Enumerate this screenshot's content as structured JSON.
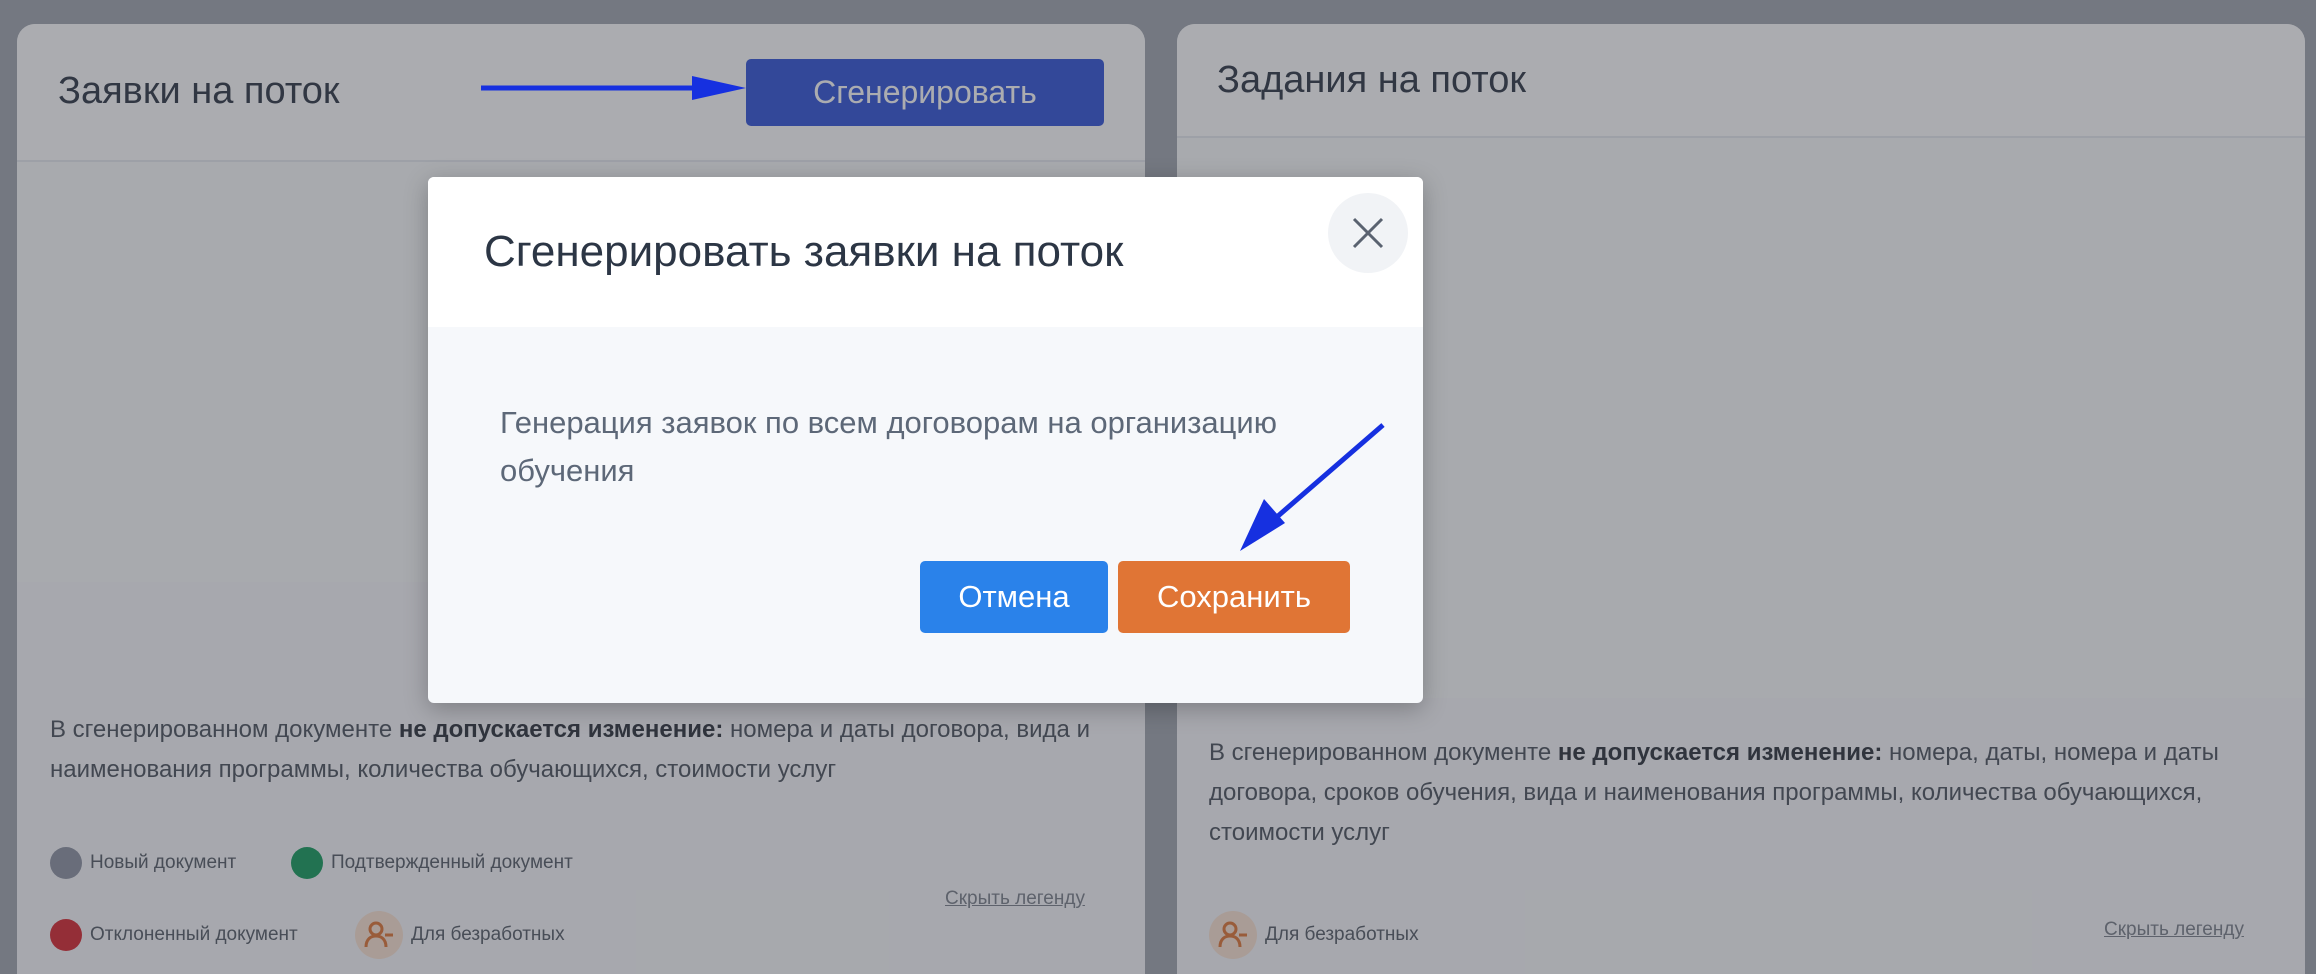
{
  "left_panel": {
    "title": "Заявки на поток",
    "generate_button": "Сгенерировать",
    "note_prefix": "В сгенерированном документе ",
    "note_bold": "не допускается изменение:",
    "note_rest": " номера и даты договора, вида и наименования программы, количества обучающихся, стоимости услуг",
    "legend": [
      {
        "label": "Новый документ",
        "color": "#8e93a3"
      },
      {
        "label": "Подтвержденный документ",
        "color": "#139b5c"
      },
      {
        "label": "Отклоненный документ",
        "color": "#d8262f"
      },
      {
        "label": "Для безработных",
        "icon": "unemployed-person-icon"
      }
    ],
    "hide_legend": "Скрыть легенду"
  },
  "right_panel": {
    "title": "Задания на поток",
    "note_prefix": "В сгенерированном документе ",
    "note_bold": "не допускается изменение:",
    "note_rest": " номера, даты, номера и даты договора, сроков обучения, вида и наименования программы, количества обучающихся, стоимости услуг",
    "legend": [
      {
        "label": "Для безработных",
        "icon": "unemployed-person-icon"
      }
    ],
    "hide_legend": "Скрыть легенду"
  },
  "modal": {
    "title": "Сгенерировать заявки на поток",
    "body": "Генерация заявок по всем договорам на организацию обучения",
    "cancel": "Отмена",
    "save": "Сохранить",
    "close_icon": "close-icon"
  },
  "colors": {
    "generate_button": "#3154d7",
    "cancel_button": "#2a82ea",
    "save_button": "#e07535",
    "annotation_arrow": "#1630e0",
    "unemployed_icon": "#e07535"
  }
}
